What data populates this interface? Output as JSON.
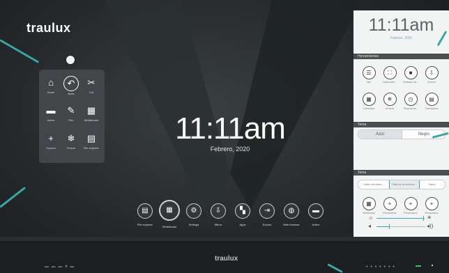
{
  "brand": "traulux",
  "bezel_brand": "traulux",
  "desktop": {
    "time": "11:11am",
    "date": "Febrero, 2020"
  },
  "quick_menu": {
    "items": [
      {
        "label": "Home",
        "icon": "home-icon",
        "glyph": "⌂"
      },
      {
        "label": "Back",
        "icon": "back-icon",
        "glyph": "↶"
      },
      {
        "label": "Cut",
        "icon": "cut-icon",
        "glyph": "✂"
      },
      {
        "label": "Active",
        "icon": "window-icon",
        "glyph": "▬"
      },
      {
        "label": "Pen",
        "icon": "pen-icon",
        "glyph": "✎"
      },
      {
        "label": "Whiteboard",
        "icon": "whiteboard-icon",
        "glyph": "▦"
      },
      {
        "label": "Custom",
        "icon": "plus-icon",
        "glyph": "+"
      },
      {
        "label": "Freeze",
        "icon": "snowflake-icon",
        "glyph": "❄"
      },
      {
        "label": "File explorer",
        "icon": "file-explorer-icon",
        "glyph": "▤"
      }
    ]
  },
  "dock": {
    "items": [
      {
        "label": "File explorer",
        "icon": "file-explorer-icon",
        "glyph": "▤"
      },
      {
        "label": "Whiteboard",
        "icon": "whiteboard-icon",
        "glyph": "▦"
      },
      {
        "label": "Settings",
        "icon": "gear-icon",
        "glyph": "⚙"
      },
      {
        "label": "Mirror",
        "icon": "mirror-icon",
        "glyph": "⇩"
      },
      {
        "label": "Apps",
        "icon": "apps-icon",
        "glyph": "▚"
      },
      {
        "label": "Source",
        "icon": "source-icon",
        "glyph": "⇥"
      },
      {
        "label": "Web browser",
        "icon": "globe-icon",
        "glyph": "◍"
      },
      {
        "label": "Active",
        "icon": "window-icon",
        "glyph": "▬"
      }
    ]
  },
  "panel": {
    "time": "11:11am",
    "date": "Febrero, 2020",
    "tools_header": "Herramientas",
    "tools": [
      {
        "label": "Wifi",
        "icon": "wifi-icon",
        "glyph": "☰"
      },
      {
        "label": "Capturador...",
        "icon": "capture-icon",
        "glyph": "⛶"
      },
      {
        "label": "Grabador de...",
        "icon": "record-icon",
        "glyph": "■"
      },
      {
        "label": "Vsharer",
        "icon": "share-icon",
        "glyph": "⇩"
      },
      {
        "label": "Calendario",
        "icon": "calendar-icon",
        "glyph": "▦"
      },
      {
        "label": "uFreeze",
        "icon": "snowflake-icon",
        "glyph": "❄"
      },
      {
        "label": "Temporizad...",
        "icon": "timer-icon",
        "glyph": "◷"
      },
      {
        "label": "Calculadora",
        "icon": "calculator-icon",
        "glyph": "▤"
      }
    ],
    "theme_header": "Tema",
    "theme_options": [
      "Azul",
      "Negro"
    ],
    "wallpaper_header": "Tema",
    "wallpapers": [
      "Salón de clase...",
      "Sala de reuniones...",
      "Salón"
    ],
    "shortcuts": [
      {
        "label": "Whiteboard",
        "icon": "whiteboard-icon",
        "glyph": "▦"
      },
      {
        "label": "Personalizar",
        "icon": "plus-icon",
        "glyph": "+"
      },
      {
        "label": "Personalizar",
        "icon": "plus-icon",
        "glyph": "+"
      },
      {
        "label": "Personalizar",
        "icon": "plus-icon",
        "glyph": "+"
      }
    ],
    "brightness_level": 0.95,
    "volume_level": 0.25
  },
  "bezel_indicators": "• • • • • • •",
  "bezel_left_marks": "▬ ▬ ▬ ■ ▬",
  "colors": {
    "accent": "#3aa6a3",
    "panel_bg": "#f2f3f3",
    "desktop_bg": "#25292b",
    "status_green": "#39c46a"
  }
}
